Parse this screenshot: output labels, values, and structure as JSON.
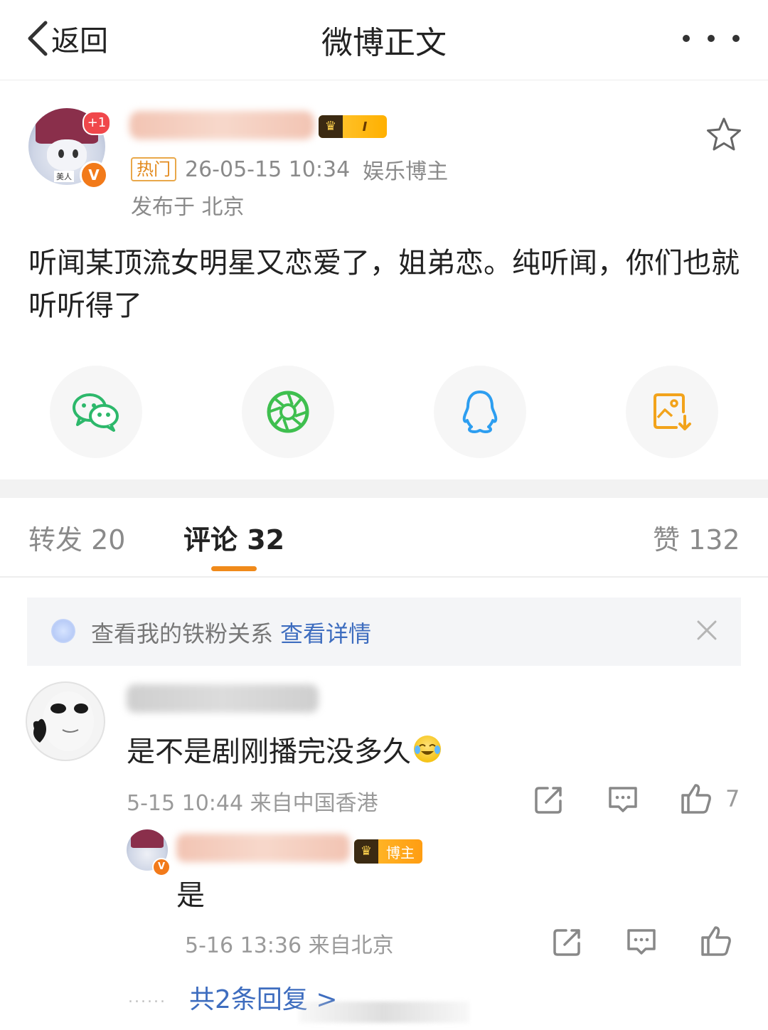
{
  "header": {
    "back_label": "返回",
    "title": "微博正文"
  },
  "post": {
    "avatar_badge": "美人",
    "notification_count": "+1",
    "verified_mark": "V",
    "crown_level": "I",
    "hot_tag": "热门",
    "timestamp": "26-05-15 10:34",
    "category": "娱乐博主",
    "location": "发布于 北京",
    "text": "听闻某顶流女明星又恋爱了，姐弟恋。纯听闻，你们也就听听得了"
  },
  "share": {
    "icons": [
      "wechat-icon",
      "moments-icon",
      "qq-icon",
      "save-image-icon"
    ],
    "colors": {
      "wechat": "#2db86b",
      "moments": "#3fbf4f",
      "qq": "#2d9ef0",
      "save": "#f2a31b"
    }
  },
  "tabs": {
    "repost": "转发 20",
    "comment": "评论 32",
    "like": "赞 132",
    "accent_color": "#f08a1a"
  },
  "notice": {
    "text": "查看我的铁粉关系",
    "link": "查看详情"
  },
  "comment": {
    "text": "是不是剧刚播完没多久",
    "meta": "5-15 10:44 来自中国香港",
    "like_count": "7"
  },
  "reply": {
    "badge": "博主",
    "text": "是",
    "meta": "5-16 13:36 来自北京"
  },
  "more_replies": {
    "dots": "......",
    "label": "共2条回复 >"
  }
}
